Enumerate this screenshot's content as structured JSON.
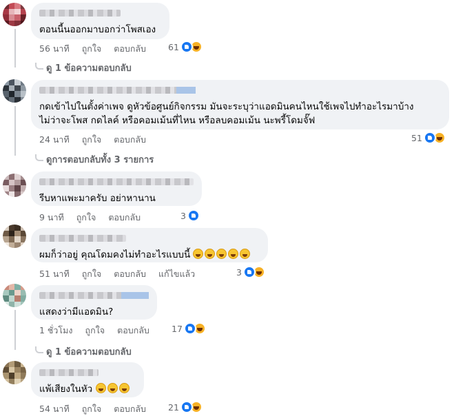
{
  "comments": [
    {
      "text": "ตอนนี้นออกมาบอกว่าโพสเอง",
      "time": "56 นาที",
      "like": "ถูกใจ",
      "reply": "ตอบกลับ",
      "reaction_count": "61",
      "replies_link": "ดู 1 ข้อความตอบกลับ"
    },
    {
      "text": "กดเข้าไปในตั้งค่าเพจ ดูหัวข้อศูนย์กิจกรรม มันจะระบุว่าแอดมินคนไหนใช้เพจไปทำอะไรมาบ้าง\nไม่ว่าจะโพส กดไลค์ หรือคอมเม้นที่ไหน หรือลบคอมเม้น นะพรี้โดมจั๊ฟ",
      "time": "24 นาที",
      "like": "ถูกใจ",
      "reply": "ตอบกลับ",
      "reaction_count": "51",
      "replies_link": "ดูการตอบกลับทั้ง 3 รายการ"
    },
    {
      "text": "รีบหาแพะมาครับ อย่าหานาน",
      "time": "9 นาที",
      "like": "ถูกใจ",
      "reply": "ตอบกลับ",
      "reaction_count": "3"
    },
    {
      "text": "ผมก็ว่าอยู่ คุณโดมคงไม่ทำอะไรแบบนี้",
      "time": "51 นาที",
      "like": "ถูกใจ",
      "reply": "ตอบกลับ",
      "edited": "แก้ไขแล้ว",
      "reaction_count": "3"
    },
    {
      "text": "แสดงว่ามีแอดมิน?",
      "time": "1 ชั่วโมง",
      "like": "ถูกใจ",
      "reply": "ตอบกลับ",
      "reaction_count": "17",
      "replies_link": "ดู 1 ข้อความตอบกลับ"
    },
    {
      "text": "แพ้เสียงในหัว",
      "time": "54 นาที",
      "like": "ถูกใจ",
      "reply": "ตอบกลับ",
      "reaction_count": "21"
    }
  ]
}
